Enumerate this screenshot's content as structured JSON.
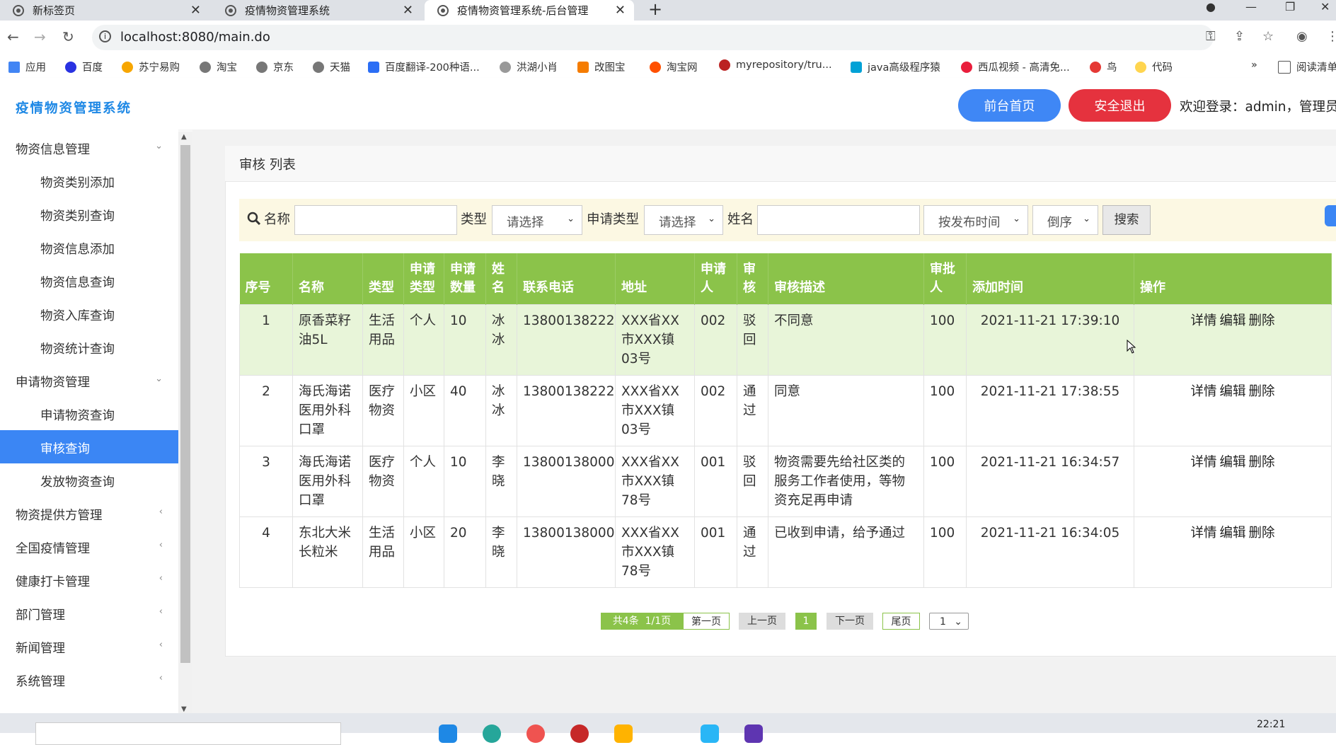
{
  "browser": {
    "tabs": [
      {
        "title": "新标签页"
      },
      {
        "title": "疫情物资管理系统"
      },
      {
        "title": "疫情物资管理系统-后台管理"
      }
    ],
    "url": "localhost:8080/main.do",
    "bookmarks": [
      "应用",
      "百度",
      "苏宁易购",
      "淘宝",
      "京东",
      "天猫",
      "百度翻译-200种语...",
      "洪湖小肖",
      "改图宝",
      "淘宝网",
      "myrepository/tru...",
      "java高级程序猿",
      "西瓜视频 - 高清免...",
      "鸟",
      "代码",
      "阅读清单"
    ]
  },
  "header": {
    "brand": "疫情物资管理系统",
    "home_button": "前台首页",
    "logout_button": "安全退出",
    "welcome": "欢迎登录：admin，管理员"
  },
  "sidebar": {
    "items": [
      {
        "label": "物资信息管理",
        "type": "group",
        "arrow": "⌄"
      },
      {
        "label": "物资类别添加",
        "type": "sub"
      },
      {
        "label": "物资类别查询",
        "type": "sub"
      },
      {
        "label": "物资信息添加",
        "type": "sub"
      },
      {
        "label": "物资信息查询",
        "type": "sub"
      },
      {
        "label": "物资入库查询",
        "type": "sub"
      },
      {
        "label": "物资统计查询",
        "type": "sub"
      },
      {
        "label": "申请物资管理",
        "type": "group",
        "arrow": "⌄"
      },
      {
        "label": "申请物资查询",
        "type": "sub"
      },
      {
        "label": "审核查询",
        "type": "sub",
        "active": true
      },
      {
        "label": "发放物资查询",
        "type": "sub"
      },
      {
        "label": "物资提供方管理",
        "type": "group",
        "arrow": "‹"
      },
      {
        "label": "全国疫情管理",
        "type": "group",
        "arrow": "‹"
      },
      {
        "label": "健康打卡管理",
        "type": "group",
        "arrow": "‹"
      },
      {
        "label": "部门管理",
        "type": "group",
        "arrow": "‹"
      },
      {
        "label": "新闻管理",
        "type": "group",
        "arrow": "‹"
      },
      {
        "label": "系统管理",
        "type": "group",
        "arrow": "‹"
      }
    ]
  },
  "panel": {
    "title": "审核 列表"
  },
  "search": {
    "name_label": "名称",
    "type_label": "类型",
    "type_value": "请选择",
    "apply_type_label": "申请类型",
    "apply_type_value": "请选择",
    "person_label": "姓名",
    "sort_value": "按发布时间",
    "order_value": "倒序",
    "search_button": "搜索"
  },
  "table": {
    "headers": [
      "序号",
      "名称",
      "类型",
      "申请类型",
      "申请数量",
      "姓名",
      "联系电话",
      "地址",
      "申请人",
      "审核",
      "审核描述",
      "审批人",
      "添加时间",
      "操作"
    ],
    "rows": [
      {
        "no": "1",
        "name": "原香菜籽油5L",
        "type": "生活用品",
        "apply_type": "个人",
        "qty": "10",
        "person": "冰冰",
        "phone": "13800138222",
        "address": "XXX省XX市XXX镇03号",
        "applicant": "002",
        "status": "驳回",
        "desc": "不同意",
        "approver": "100",
        "time": "2021-11-21 17:39:10"
      },
      {
        "no": "2",
        "name": "海氏海诺医用外科口罩",
        "type": "医疗物资",
        "apply_type": "小区",
        "qty": "40",
        "person": "冰冰",
        "phone": "13800138222",
        "address": "XXX省XX市XXX镇03号",
        "applicant": "002",
        "status": "通过",
        "desc": "同意",
        "approver": "100",
        "time": "2021-11-21 17:38:55"
      },
      {
        "no": "3",
        "name": "海氏海诺医用外科口罩",
        "type": "医疗物资",
        "apply_type": "个人",
        "qty": "10",
        "person": "李晓",
        "phone": "13800138000",
        "address": "XXX省XX市XXX镇78号",
        "applicant": "001",
        "status": "驳回",
        "desc": "物资需要先给社区类的服务工作者使用，等物资充足再申请",
        "approver": "100",
        "time": "2021-11-21 16:34:57"
      },
      {
        "no": "4",
        "name": "东北大米长粒米",
        "type": "生活用品",
        "apply_type": "小区",
        "qty": "20",
        "person": "李晓",
        "phone": "13800138000",
        "address": "XXX省XX市XXX镇78号",
        "applicant": "001",
        "status": "通过",
        "desc": "已收到申请，给予通过",
        "approver": "100",
        "time": "2021-11-21 16:34:05"
      }
    ],
    "ops": [
      "详情",
      "编辑",
      "删除"
    ]
  },
  "pagination": {
    "total": "共4条",
    "pages": "1/1页",
    "first": "第一页",
    "prev": "上一页",
    "current": "1",
    "next": "下一页",
    "last": "尾页",
    "jump_value": "1"
  },
  "taskbar": {
    "clock": "22:21"
  },
  "colors": {
    "accent": "#3b86f4",
    "danger": "#e5323e",
    "table_header": "#8bc34a",
    "brand": "#1e88e5"
  }
}
